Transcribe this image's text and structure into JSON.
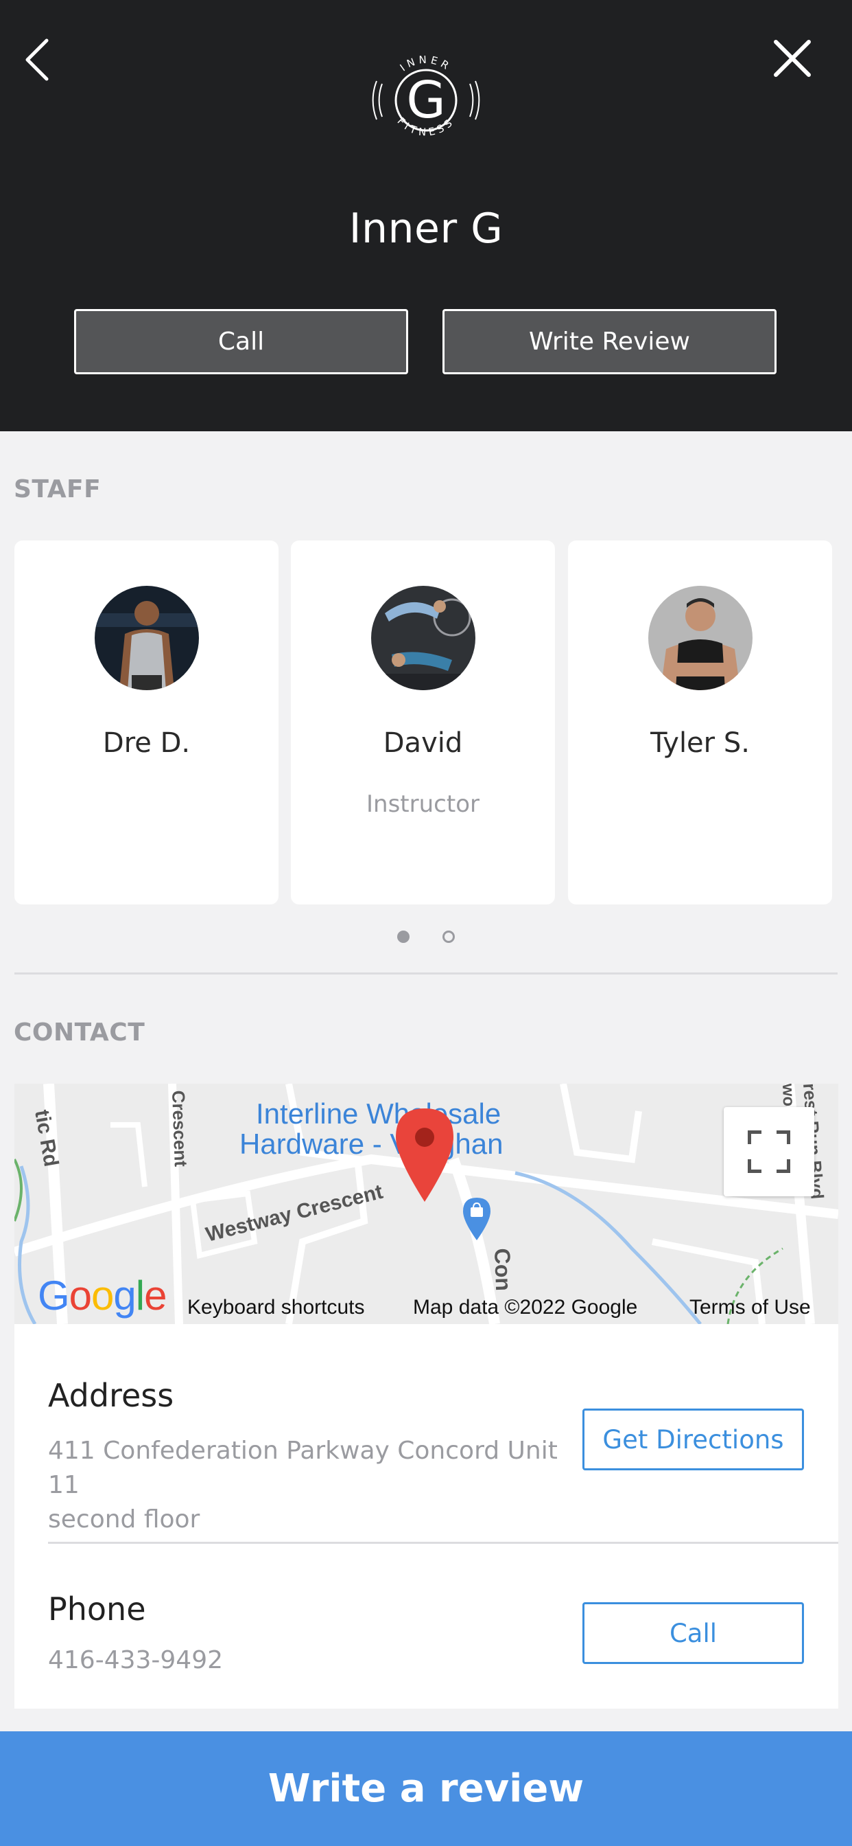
{
  "header": {
    "logo_text_top": "INNER",
    "logo_letter": "G",
    "logo_text_bottom": "FITNESS",
    "title": "Inner G",
    "call_label": "Call",
    "write_review_label": "Write Review"
  },
  "staff": {
    "section_label": "STAFF",
    "members": [
      {
        "name": "Dre D.",
        "role": ""
      },
      {
        "name": "David",
        "role": "Instructor"
      },
      {
        "name": "Tyler S.",
        "role": ""
      }
    ],
    "page_count": 2,
    "active_page": 1
  },
  "contact": {
    "section_label": "CONTACT",
    "map": {
      "labels": {
        "poi_line1": "Interline Wholesale",
        "poi_line2": "Hardware - Vaughan",
        "street1": "Westway Crescent",
        "street2": "Crescent",
        "street3": "tic Rd",
        "street4": "Con",
        "street5": "rest Run Blvd",
        "street6": "wo"
      },
      "google_logo": "Google",
      "keyboard_shortcuts": "Keyboard shortcuts",
      "map_data": "Map data ©2022 Google",
      "terms": "Terms of Use"
    },
    "address": {
      "title": "Address",
      "line1": "411 Confederation Parkway Concord Unit 11",
      "line2": "second floor",
      "button_label": "Get Directions"
    },
    "phone": {
      "title": "Phone",
      "number": "416-433-9492",
      "button_label": "Call"
    }
  },
  "cta": {
    "label": "Write a review"
  },
  "colors": {
    "header_bg": "#1f2022",
    "accent_blue": "#4a90e2",
    "link_blue": "#3b8fde",
    "muted_text": "#9a9ba0",
    "page_bg": "#f2f2f3"
  }
}
